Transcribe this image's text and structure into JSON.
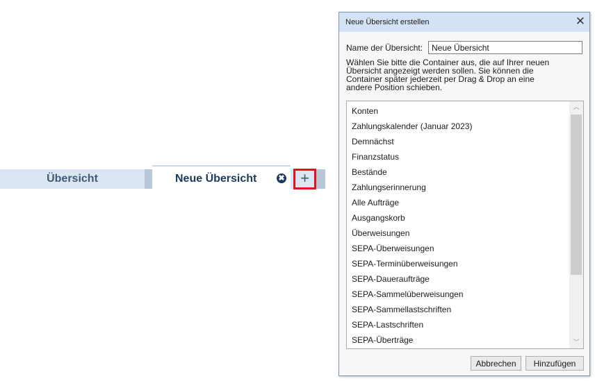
{
  "tabs": {
    "items": [
      {
        "label": "Übersicht",
        "active": false
      },
      {
        "label": "Neue Übersicht",
        "active": true
      }
    ],
    "close_glyph": "✖",
    "add_glyph": "+",
    "highlight_color": "#e0141e"
  },
  "dialog": {
    "title": "Neue Übersicht erstellen",
    "close_glyph": "✕",
    "name_label": "Name der Übersicht:",
    "name_value": "Neue Übersicht",
    "instructions": [
      "Wählen Sie bitte die Container aus, die auf Ihrer neuen",
      "Übersicht angezeigt werden sollen. Sie können die",
      "Container später jederzeit per Drag & Drop an eine",
      "andere Position schieben."
    ],
    "containers": [
      "Konten",
      "Zahlungskalender (Januar 2023)",
      "Demnächst",
      "Finanzstatus",
      "Bestände",
      "Zahlungserinnerung",
      "Alle Aufträge",
      "Ausgangskorb",
      "Überweisungen",
      "SEPA-Überweisungen",
      "SEPA-Terminüberweisungen",
      "SEPA-Daueraufträge",
      "SEPA-Sammelüberweisungen",
      "SEPA-Sammellastschriften",
      "SEPA-Lastschriften",
      "SEPA-Überträge"
    ],
    "scroll_up_glyph": "︿",
    "scroll_down_glyph": "﹀",
    "cancel_label": "Abbrechen",
    "add_label": "Hinzufügen"
  }
}
